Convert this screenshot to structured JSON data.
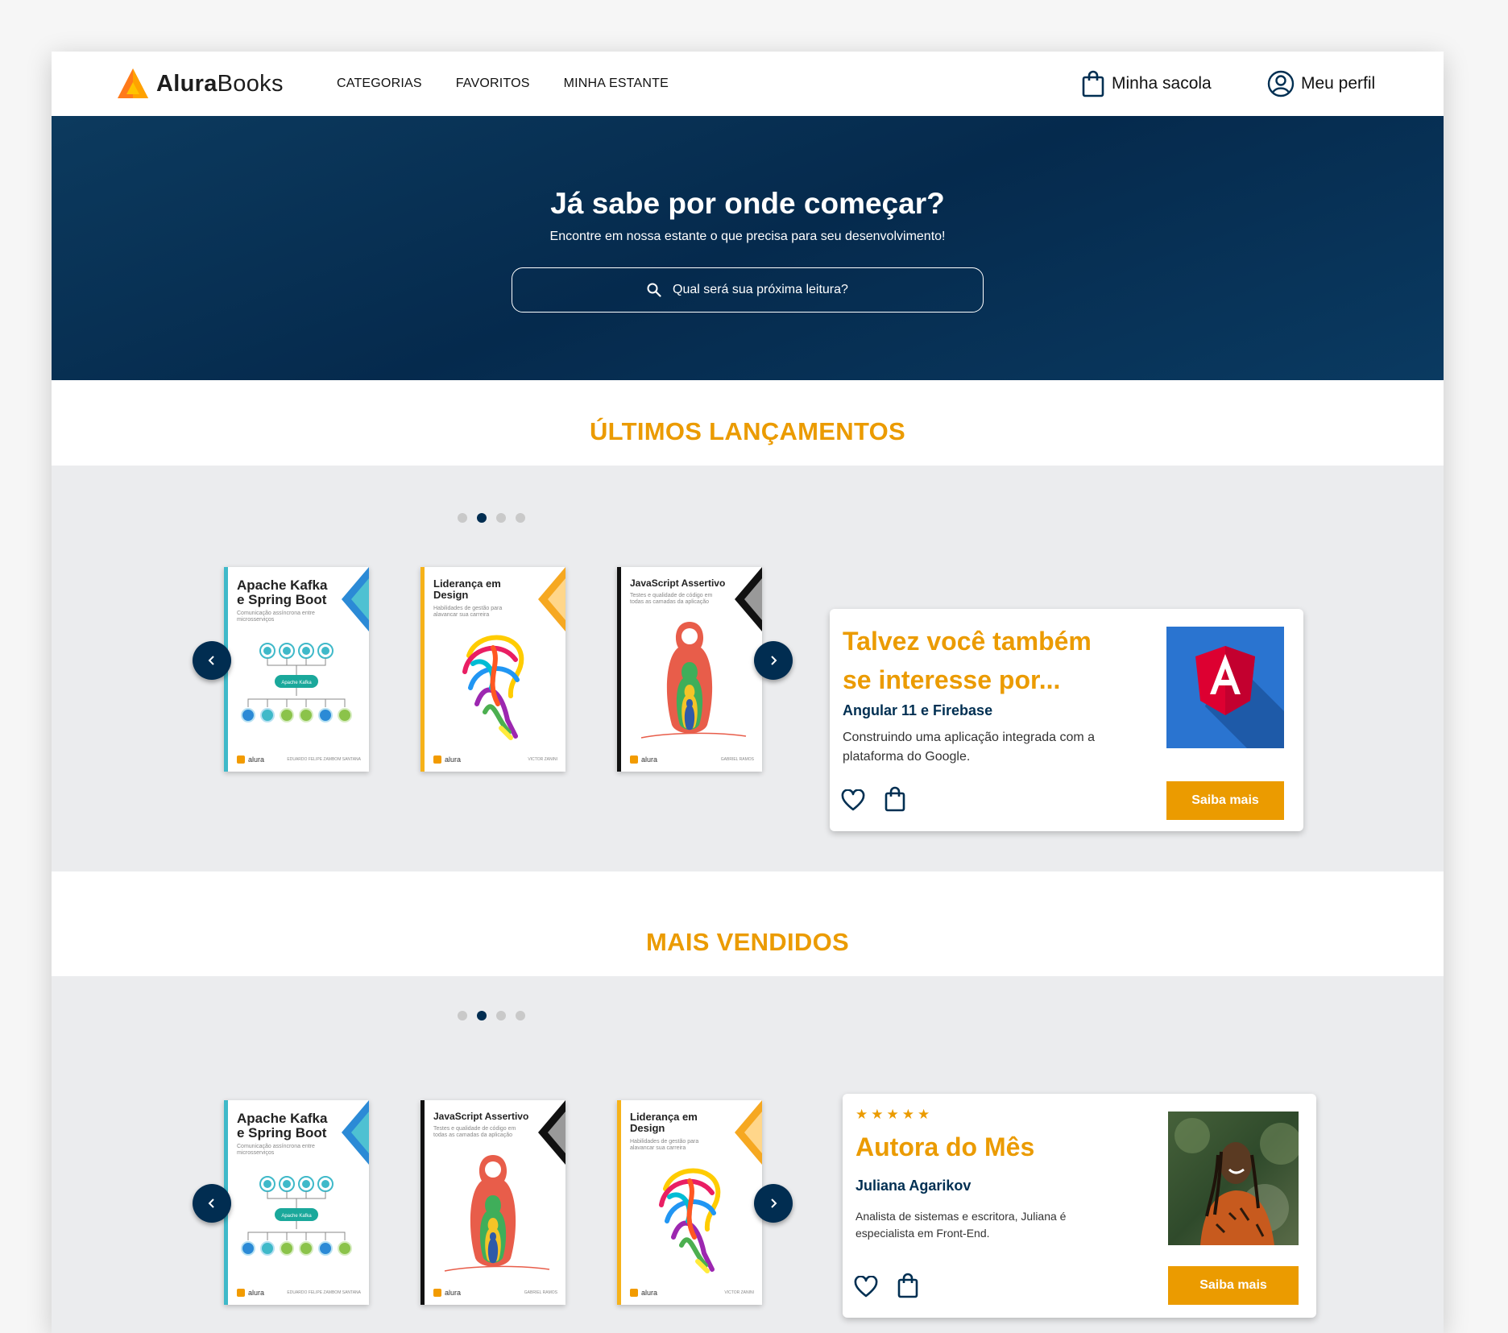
{
  "header": {
    "logo": {
      "brand_bold": "Alura",
      "brand_light": "Books"
    },
    "nav": [
      {
        "label": "CATEGORIAS"
      },
      {
        "label": "FAVORITOS"
      },
      {
        "label": "MINHA ESTANTE"
      }
    ],
    "bag_label": "Minha sacola",
    "profile_label": "Meu perfil"
  },
  "hero": {
    "title": "Já sabe por onde começar?",
    "subtitle": "Encontre em nossa estante o que precisa para seu desenvolvimento!",
    "search_placeholder": "Qual será sua próxima leitura?"
  },
  "releases": {
    "title": "ÚLTIMOS LANÇAMENTOS",
    "dots": {
      "count": 4,
      "active": 2
    },
    "books": [
      {
        "title": "Apache Kafka e Spring Boot",
        "subtitle": "Comunicação assíncrona entre microsserviços",
        "author": "EDUARDO FELIPE ZAMBOM SANTANA",
        "publisher": "alura",
        "cover": "kafka"
      },
      {
        "title": "Liderança em Design",
        "subtitle": "Habilidades de gestão para alavancar sua carreira",
        "author": "VICTOR ZANINI",
        "publisher": "alura",
        "cover": "design"
      },
      {
        "title": "JavaScript Assertivo",
        "subtitle": "Testes e qualidade de código em todas as camadas da aplicação",
        "author": "GABRIEL RAMOS",
        "publisher": "alura",
        "cover": "js"
      }
    ],
    "card": {
      "title": "Talvez você também se interesse por...",
      "name": "Angular 11 e Firebase",
      "description": "Construindo uma aplicação integrada com a plataforma do Google.",
      "button": "Saiba mais",
      "image_icon": "angular-logo-icon"
    }
  },
  "bestsellers": {
    "title": "MAIS VENDIDOS",
    "dots": {
      "count": 4,
      "active": 2
    },
    "books": [
      {
        "title": "Apache Kafka e Spring Boot",
        "subtitle": "Comunicação assíncrona entre microsserviços",
        "author": "EDUARDO FELIPE ZAMBOM SANTANA",
        "publisher": "alura",
        "cover": "kafka"
      },
      {
        "title": "JavaScript Assertivo",
        "subtitle": "Testes e qualidade de código em todas as camadas da aplicação",
        "author": "GABRIEL RAMOS",
        "publisher": "alura",
        "cover": "js"
      },
      {
        "title": "Liderança em Design",
        "subtitle": "Habilidades de gestão para alavancar sua carreira",
        "author": "VICTOR ZANINI",
        "publisher": "alura",
        "cover": "design"
      }
    ],
    "card": {
      "rating": 5,
      "stars": "★★★★★",
      "title": "Autora do Mês",
      "name": "Juliana Agarikov",
      "description": "Analista de sistemas e escritora, Juliana é especialista em Front-End.",
      "button": "Saiba mais",
      "image_icon": "author-photo"
    }
  },
  "colors": {
    "accent": "#EB9B00",
    "navy": "#002F52",
    "gray_bg": "#EBECEE"
  }
}
